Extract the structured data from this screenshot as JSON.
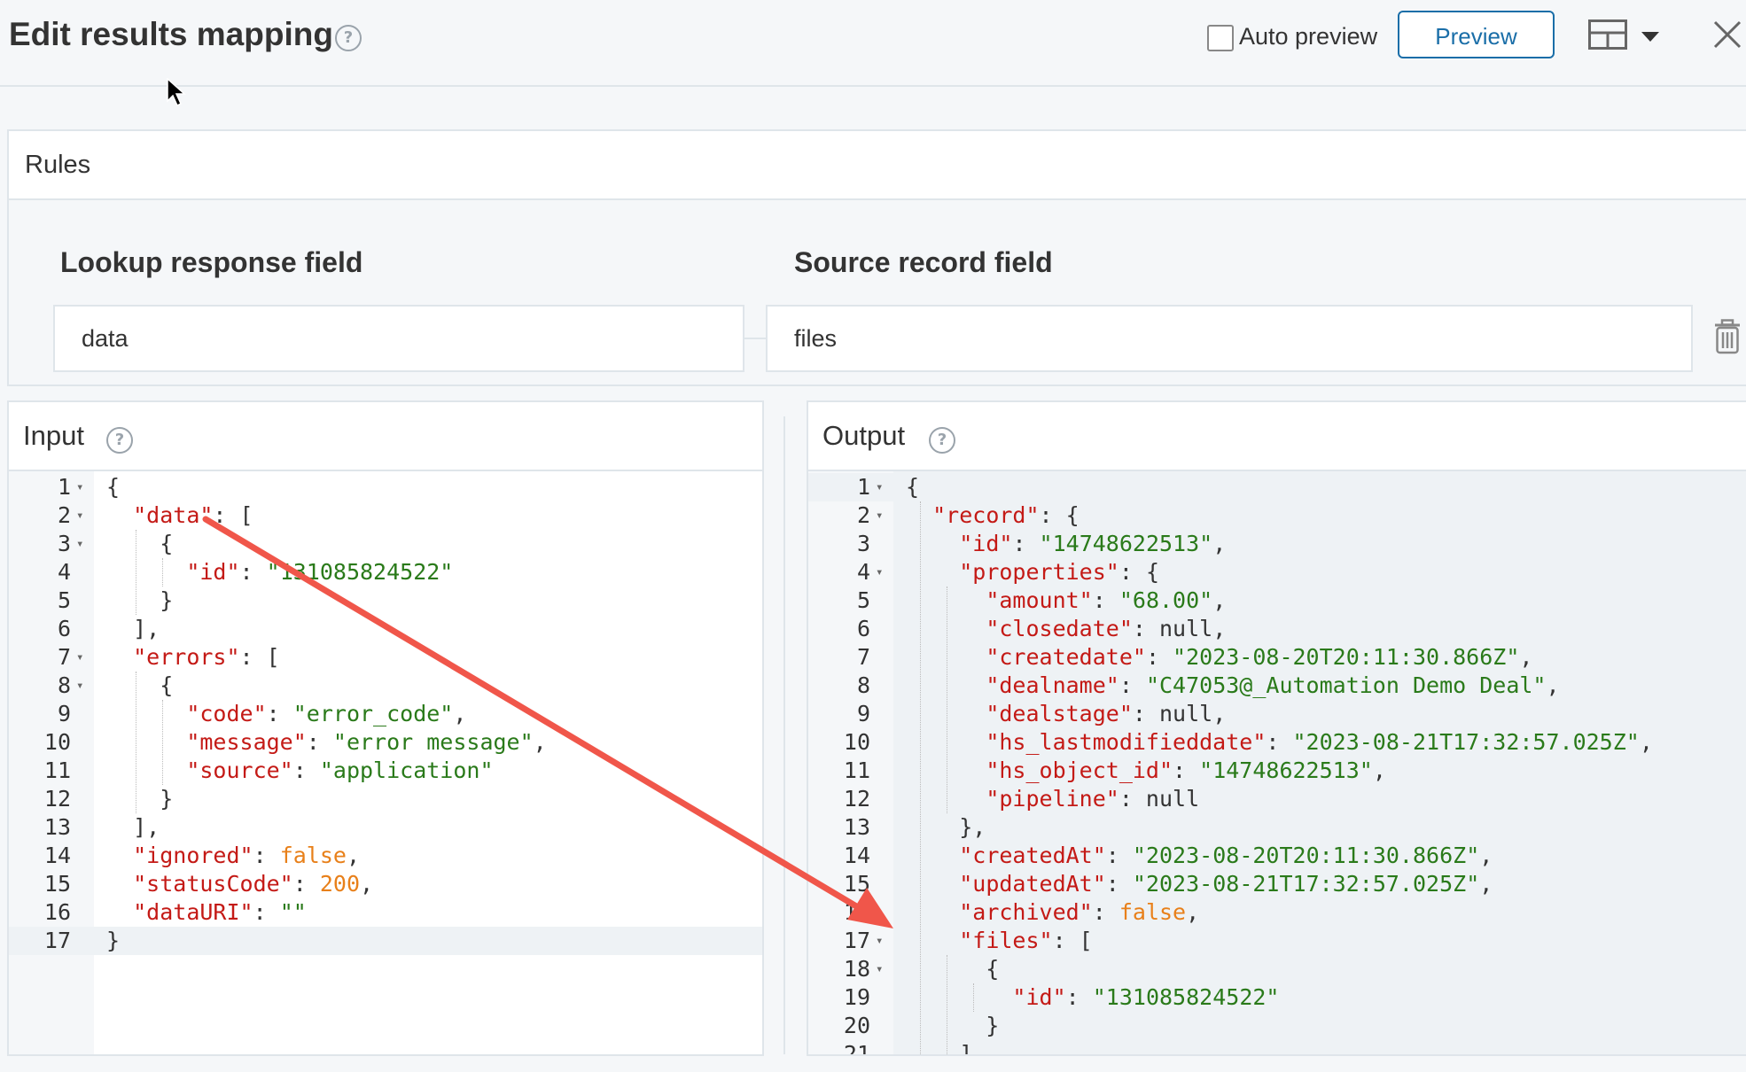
{
  "header": {
    "title": "Edit results mapping",
    "auto_preview_label": "Auto preview",
    "auto_preview_checked": false,
    "preview_button": "Preview"
  },
  "icons": {
    "help": "help-circle-icon",
    "layout": "layout-icon",
    "caret": "caret-down-icon",
    "close": "close-icon",
    "trash": "trash-icon",
    "cursor": "mouse-cursor-icon",
    "arrow": "annotation-arrow"
  },
  "rules": {
    "title": "Rules",
    "lookup_label": "Lookup response field",
    "source_label": "Source record field",
    "lookup_value": "data",
    "source_value": "files"
  },
  "input": {
    "title": "Input",
    "lines": [
      "{",
      "  \"data\": [",
      "    {",
      "      \"id\": \"131085824522\"",
      "    }",
      "  ],",
      "  \"errors\": [",
      "    {",
      "      \"code\": \"error_code\",",
      "      \"message\": \"error message\",",
      "      \"source\": \"application\"",
      "    }",
      "  ],",
      "  \"ignored\": false,",
      "  \"statusCode\": 200,",
      "  \"dataURI\": \"\"",
      "}"
    ],
    "folds": [
      1,
      2,
      3,
      7,
      8
    ]
  },
  "output": {
    "title": "Output",
    "lines": [
      "{",
      "  \"record\": {",
      "    \"id\": \"14748622513\",",
      "    \"properties\": {",
      "      \"amount\": \"68.00\",",
      "      \"closedate\": null,",
      "      \"createdate\": \"2023-08-20T20:11:30.866Z\",",
      "      \"dealname\": \"C47053@_Automation Demo Deal\",",
      "      \"dealstage\": null,",
      "      \"hs_lastmodifieddate\": \"2023-08-21T17:32:57.025Z\",",
      "      \"hs_object_id\": \"14748622513\",",
      "      \"pipeline\": null",
      "    },",
      "    \"createdAt\": \"2023-08-20T20:11:30.866Z\",",
      "    \"updatedAt\": \"2023-08-21T17:32:57.025Z\",",
      "    \"archived\": false,",
      "    \"files\": [",
      "      {",
      "        \"id\": \"131085824522\"",
      "      }",
      "    ]"
    ],
    "folds": [
      1,
      2,
      4,
      17,
      18
    ]
  },
  "colors": {
    "key": "#c41a16",
    "string": "#2a7a1a",
    "literal": "#e8801a",
    "accent": "#1a6ea8",
    "arrow": "#f0564a"
  }
}
